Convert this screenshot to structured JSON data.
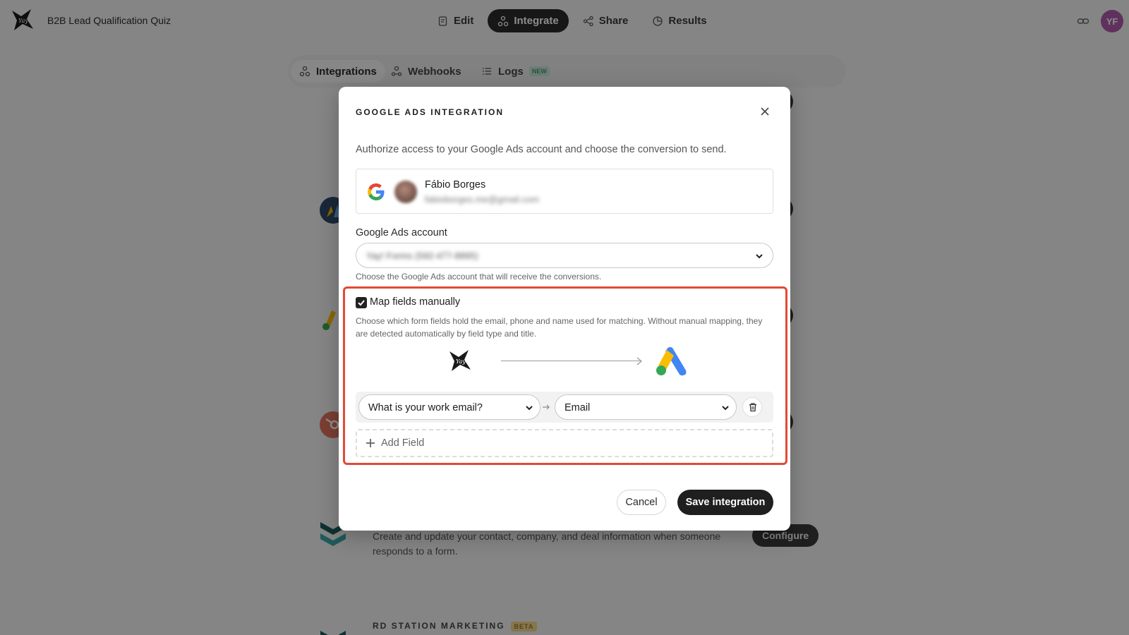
{
  "app": {
    "title": "B2B Lead Qualification Quiz",
    "avatar_initials": "YF"
  },
  "nav": {
    "edit": "Edit",
    "integrate": "Integrate",
    "share": "Share",
    "results": "Results"
  },
  "subtabs": {
    "integrations": "Integrations",
    "webhooks": "Webhooks",
    "logs": "Logs",
    "logs_badge": "NEW"
  },
  "background": {
    "configure_label": "Configure",
    "partial_configure": "gure",
    "hubspot_description": "Create and update your contact, company, and deal information when someone responds to a form.",
    "rd_station_heading": "RD STATION MARKETING",
    "rd_station_badge": "BETA"
  },
  "modal": {
    "title": "GOOGLE ADS INTEGRATION",
    "intro": "Authorize access to your Google Ads account and choose the conversion to send.",
    "user_name": "Fábio Borges",
    "user_email": "fabioborges.me@gmail.com",
    "account_label": "Google Ads account",
    "account_value": "Yay! Forms (592-477-8895)",
    "account_helper": "Choose the Google Ads account that will receive the conversions.",
    "map_checkbox_label": "Map fields manually",
    "map_checked": true,
    "map_description": "Choose which form fields hold the email, phone and name used for matching. Without manual mapping, they are detected automatically by field type and title.",
    "mapping_rows": [
      {
        "source": "What is your work email?",
        "target": "Email"
      }
    ],
    "add_field_label": "Add Field",
    "cancel_label": "Cancel",
    "save_label": "Save integration"
  },
  "colors": {
    "highlight": "#e14a36",
    "primary": "#1f1f1f",
    "avatar": "#b05aa8"
  }
}
